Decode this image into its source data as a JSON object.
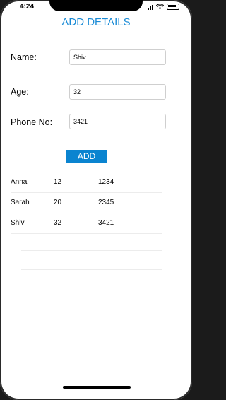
{
  "status_bar": {
    "time": "4:24"
  },
  "header": {
    "title": "ADD DETAILS"
  },
  "form": {
    "name_label": "Name:",
    "name_value": "Shiv",
    "age_label": "Age:",
    "age_value": "32",
    "phone_label": "Phone No:",
    "phone_value": "3421",
    "add_label": "ADD"
  },
  "table": {
    "rows": [
      {
        "name": "Anna",
        "age": "12",
        "phone": "1234"
      },
      {
        "name": "Sarah",
        "age": "20",
        "phone": "2345"
      },
      {
        "name": "Shiv",
        "age": "32",
        "phone": "3421"
      }
    ]
  },
  "colors": {
    "accent": "#1a8bd6",
    "button": "#0a84d0"
  }
}
